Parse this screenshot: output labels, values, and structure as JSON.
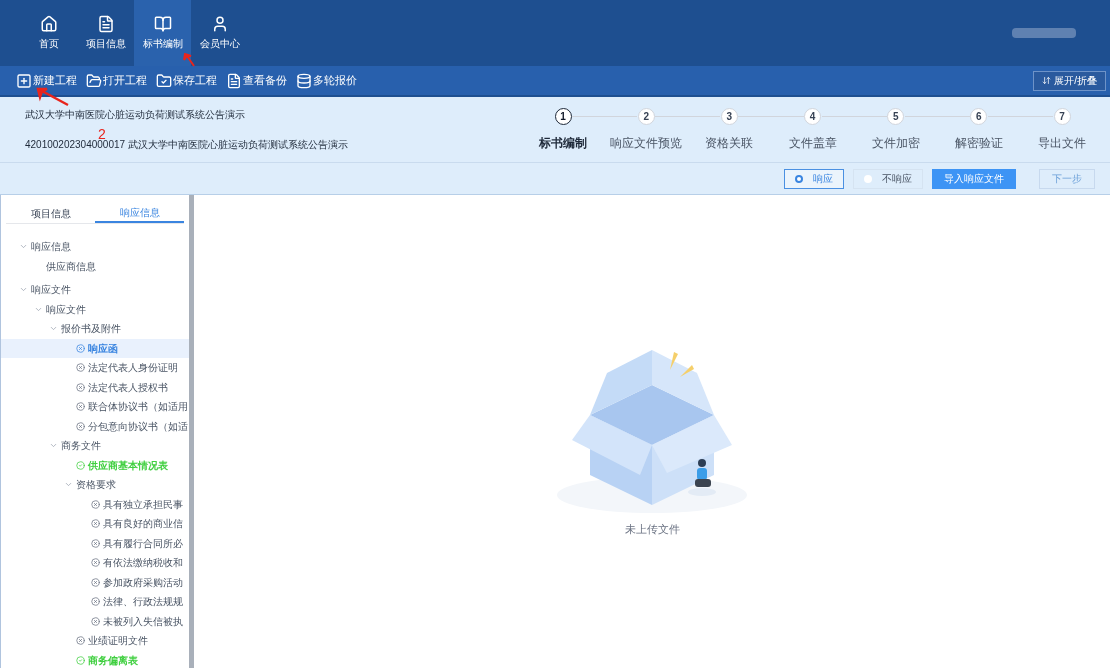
{
  "nav": {
    "tabs": [
      {
        "label": "首页",
        "selected": false
      },
      {
        "label": "项目信息",
        "selected": false
      },
      {
        "label": "标书编制",
        "selected": true
      },
      {
        "label": "会员中心",
        "selected": false
      }
    ]
  },
  "toolbar": {
    "items": [
      {
        "label": "新建工程"
      },
      {
        "label": "打开工程"
      },
      {
        "label": "保存工程"
      },
      {
        "label": "查看备份"
      },
      {
        "label": "多轮报价"
      }
    ],
    "toggle": "展开/折叠"
  },
  "project": {
    "title": "武汉大学中南医院心脏运动负荷测试系统公告演示",
    "code_line": "420100202304000017 武汉大学中南医院心脏运动负荷测试系统公告演示"
  },
  "steps": [
    {
      "number": "1",
      "label": "标书编制",
      "selected": true
    },
    {
      "number": "2",
      "label": "响应文件预览",
      "selected": false
    },
    {
      "number": "3",
      "label": "资格关联",
      "selected": false
    },
    {
      "number": "4",
      "label": "文件盖章",
      "selected": false
    },
    {
      "number": "5",
      "label": "文件加密",
      "selected": false
    },
    {
      "number": "6",
      "label": "解密验证",
      "selected": false
    },
    {
      "number": "7",
      "label": "导出文件",
      "selected": false
    }
  ],
  "actions": {
    "radios": [
      {
        "label": "响应",
        "selected": true
      },
      {
        "label": "不响应",
        "selected": false
      }
    ],
    "import_button": "导入响应文件",
    "next_button": "下一步"
  },
  "sidebar": {
    "tabs": [
      {
        "label": "项目信息",
        "selected": false
      },
      {
        "label": "响应信息",
        "selected": true
      }
    ],
    "tree": [
      {
        "label": "响应信息",
        "expanded": true,
        "children": [
          {
            "label": "供应商信息"
          }
        ]
      },
      {
        "label": "响应文件",
        "expanded": true,
        "children": [
          {
            "label": "响应文件",
            "expanded": true,
            "children": [
              {
                "label": "报价书及附件",
                "expanded": true,
                "children": [
                  {
                    "label": "响应函",
                    "kind": "pending",
                    "selected": true
                  },
                  {
                    "label": "法定代表人身份证明",
                    "kind": "pending",
                    "selected": false
                  },
                  {
                    "label": "法定代表人授权书",
                    "kind": "pending",
                    "selected": false
                  },
                  {
                    "label": "联合体协议书（如适用",
                    "kind": "pending",
                    "selected": false
                  },
                  {
                    "label": "分包意向协议书（如适",
                    "kind": "pending",
                    "selected": false
                  }
                ]
              },
              {
                "label": "商务文件",
                "expanded": true,
                "children": [
                  {
                    "label": "供应商基本情况表",
                    "kind": "done",
                    "selected": false
                  },
                  {
                    "label": "资格要求",
                    "expanded": true,
                    "children": [
                      {
                        "label": "具有独立承担民事",
                        "kind": "pending",
                        "selected": false
                      },
                      {
                        "label": "具有良好的商业信",
                        "kind": "pending",
                        "selected": false
                      },
                      {
                        "label": "具有履行合同所必",
                        "kind": "pending",
                        "selected": false
                      },
                      {
                        "label": "有依法缴纳税收和",
                        "kind": "pending",
                        "selected": false
                      },
                      {
                        "label": "参加政府采购活动",
                        "kind": "pending",
                        "selected": false
                      },
                      {
                        "label": "法律、行政法规规",
                        "kind": "pending",
                        "selected": false
                      },
                      {
                        "label": "未被列入失信被执",
                        "kind": "pending",
                        "selected": false
                      }
                    ]
                  },
                  {
                    "label": "业绩证明文件",
                    "kind": "pending",
                    "selected": false
                  },
                  {
                    "label": "商务偏离表",
                    "kind": "done",
                    "selected": false
                  }
                ]
              }
            ]
          }
        ]
      }
    ]
  },
  "empty_state": {
    "message": "未上传文件"
  },
  "annotations": [
    {
      "text": "2"
    }
  ]
}
